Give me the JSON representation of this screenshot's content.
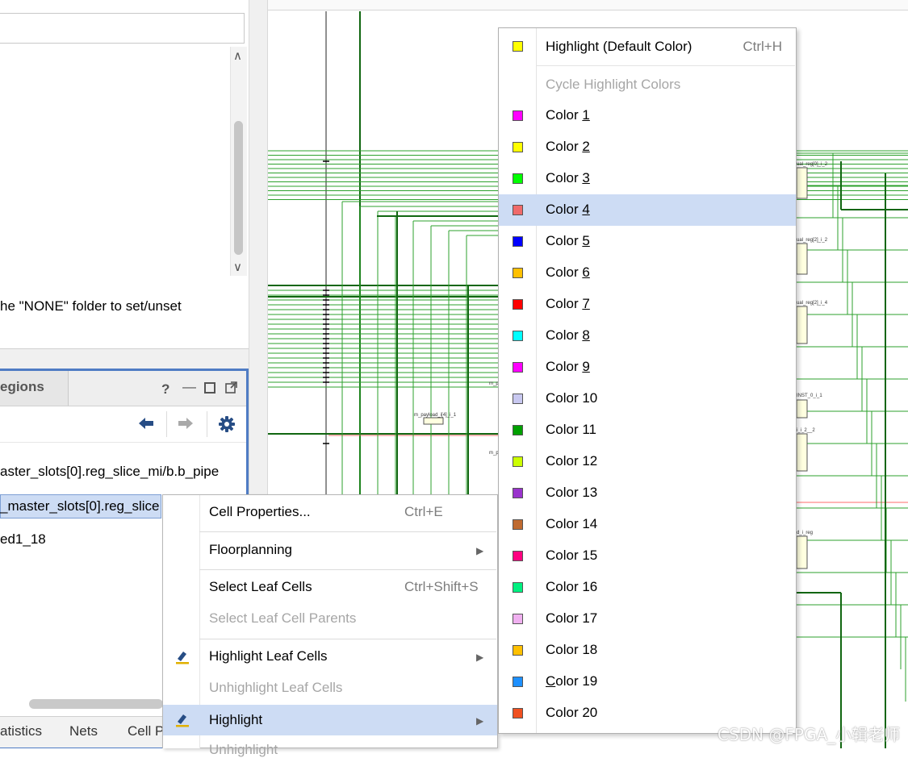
{
  "top_panel": {
    "hint_text": "he \"NONE\" folder to set/unset"
  },
  "bottom_panel": {
    "tab_label": "egions",
    "help_label": "?",
    "row1": "aster_slots[0].reg_slice_mi/b.b_pipe",
    "row2": "_master_slots[0].reg_slice",
    "row3": "ed1_18",
    "bottom_tabs": [
      "atistics",
      "Nets",
      "Cell P"
    ]
  },
  "context_menu": {
    "items": [
      {
        "label": "Cell Properties...",
        "shortcut": "Ctrl+E"
      },
      {
        "label": "Floorplanning"
      },
      {
        "label": "Select Leaf Cells",
        "shortcut": "Ctrl+Shift+S"
      },
      {
        "label": "Select Leaf Cell Parents"
      },
      {
        "label": "Highlight Leaf Cells"
      },
      {
        "label": "Unhighlight Leaf Cells"
      },
      {
        "label": "Highlight"
      },
      {
        "label": "Unhighlight"
      }
    ]
  },
  "color_menu": {
    "default": {
      "label": "Highlight (Default Color)",
      "shortcut": "Ctrl+H",
      "color": "#ffff00"
    },
    "cycle_label": "Cycle Highlight Colors",
    "colors": [
      {
        "pre": "Color ",
        "mn": "1",
        "post": "",
        "color": "#ff00ff"
      },
      {
        "pre": "Color ",
        "mn": "2",
        "post": "",
        "color": "#ffff00"
      },
      {
        "pre": "Color ",
        "mn": "3",
        "post": "",
        "color": "#00ff00"
      },
      {
        "pre": "Color ",
        "mn": "4",
        "post": "",
        "color": "#f06a6a"
      },
      {
        "pre": "Color ",
        "mn": "5",
        "post": "",
        "color": "#0000ff"
      },
      {
        "pre": "Color ",
        "mn": "6",
        "post": "",
        "color": "#ffc000"
      },
      {
        "pre": "Color ",
        "mn": "7",
        "post": "",
        "color": "#ff0000"
      },
      {
        "pre": "Color ",
        "mn": "8",
        "post": "",
        "color": "#00ffff"
      },
      {
        "pre": "Color ",
        "mn": "9",
        "post": "",
        "color": "#ff00ff"
      },
      {
        "pre": "Color 10",
        "mn": "",
        "post": "",
        "color": "#c8c8f0"
      },
      {
        "pre": "Color 11",
        "mn": "",
        "post": "",
        "color": "#00a000"
      },
      {
        "pre": "Color 12",
        "mn": "",
        "post": "",
        "color": "#ccff00"
      },
      {
        "pre": "Color 13",
        "mn": "",
        "post": "",
        "color": "#9933cc"
      },
      {
        "pre": "Color 14",
        "mn": "",
        "post": "",
        "color": "#bf6a30"
      },
      {
        "pre": "Color 15",
        "mn": "",
        "post": "",
        "color": "#ff0080"
      },
      {
        "pre": "Color 16",
        "mn": "",
        "post": "",
        "color": "#00f080"
      },
      {
        "pre": "Color 17",
        "mn": "",
        "post": "",
        "color": "#f0b0f0"
      },
      {
        "pre": "Color 18",
        "mn": "",
        "post": "",
        "color": "#ffc000"
      },
      {
        "pre": "",
        "mn": "C",
        "post": "olor 19",
        "color": "#1e90ff"
      },
      {
        "pre": "Color 20",
        "mn": "",
        "post": "",
        "color": "#f05020"
      }
    ],
    "selected_index": 3
  },
  "schematic_labels": [
    "m_payload_i[4]_i_1",
    "ual_reg[0]_i_2",
    "ual_reg[2]_i_2",
    "ual_reg[2]_i_4",
    "INST_0_i_1",
    "i_i_2__2",
    "d_i_reg",
    "m_p",
    "m_p"
  ],
  "watermark": "CSDN @FPGA_小辑老师",
  "colors": {
    "accent_blue": "#4f7cc4",
    "selection": "#cddcf4",
    "wire_green": "#2ca02c",
    "wire_dark": "#116611",
    "wire_red": "#ff6b6b"
  }
}
